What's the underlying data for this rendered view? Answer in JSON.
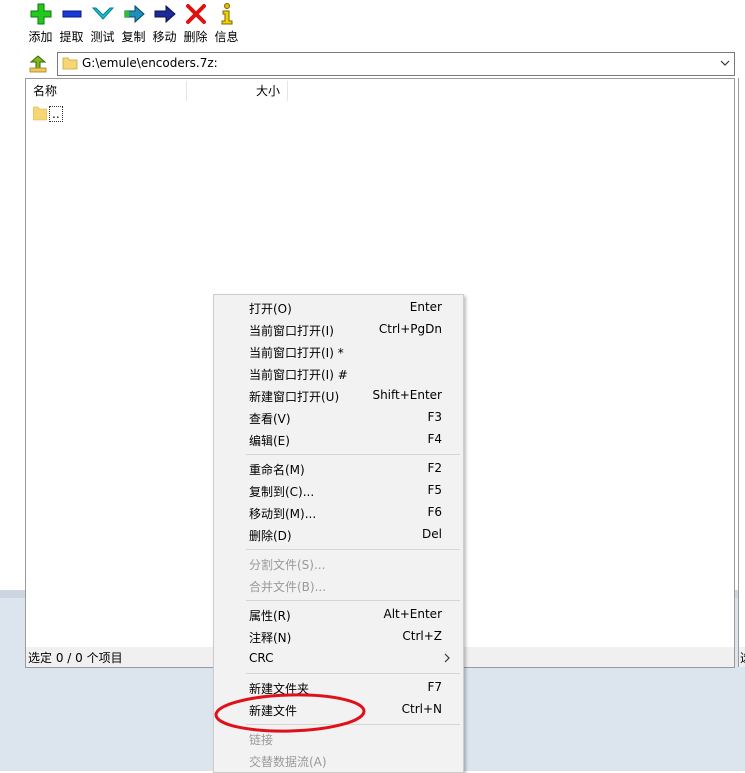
{
  "toolbar": {
    "buttons": [
      {
        "label": "添加",
        "icon": "plus-icon"
      },
      {
        "label": "提取",
        "icon": "minus-icon"
      },
      {
        "label": "测试",
        "icon": "checkmark-icon"
      },
      {
        "label": "复制",
        "icon": "copy-arrow-icon"
      },
      {
        "label": "移动",
        "icon": "move-arrow-icon"
      },
      {
        "label": "删除",
        "icon": "delete-x-icon"
      },
      {
        "label": "信息",
        "icon": "info-icon"
      }
    ]
  },
  "pathbar": {
    "path": "G:\\emule\\encoders.7z:"
  },
  "filelist": {
    "columns": [
      "名称",
      "大小"
    ],
    "rows": [
      {
        "name": ".."
      }
    ]
  },
  "status": {
    "text": "选定 0 / 0 个项目"
  },
  "status_right_text": "选",
  "context_menu": {
    "items": [
      {
        "label": "打开(O)",
        "shortcut": "Enter",
        "disabled": false
      },
      {
        "label": "当前窗口打开(I)",
        "shortcut": "Ctrl+PgDn",
        "disabled": false
      },
      {
        "label": "当前窗口打开(I) *",
        "shortcut": "",
        "disabled": false
      },
      {
        "label": "当前窗口打开(I) #",
        "shortcut": "",
        "disabled": false
      },
      {
        "label": "新建窗口打开(U)",
        "shortcut": "Shift+Enter",
        "disabled": false
      },
      {
        "label": "查看(V)",
        "shortcut": "F3",
        "disabled": false
      },
      {
        "label": "编辑(E)",
        "shortcut": "F4",
        "disabled": false
      },
      {
        "label": "重命名(M)",
        "shortcut": "F2",
        "disabled": false
      },
      {
        "label": "复制到(C)...",
        "shortcut": "F5",
        "disabled": false
      },
      {
        "label": "移动到(M)...",
        "shortcut": "F6",
        "disabled": false
      },
      {
        "label": "删除(D)",
        "shortcut": "Del",
        "disabled": false
      },
      {
        "label": "分割文件(S)...",
        "shortcut": "",
        "disabled": true
      },
      {
        "label": "合并文件(B)...",
        "shortcut": "",
        "disabled": true
      },
      {
        "label": "属性(R)",
        "shortcut": "Alt+Enter",
        "disabled": false
      },
      {
        "label": "注释(N)",
        "shortcut": "Ctrl+Z",
        "disabled": false
      },
      {
        "label": "CRC",
        "shortcut": "",
        "disabled": false,
        "submenu": true
      },
      {
        "label": "新建文件夹",
        "shortcut": "F7",
        "disabled": false
      },
      {
        "label": "新建文件",
        "shortcut": "Ctrl+N",
        "disabled": false,
        "highlighted": true
      },
      {
        "label": "链接",
        "shortcut": "",
        "disabled": true
      },
      {
        "label": "交替数据流(A)",
        "shortcut": "",
        "disabled": true
      }
    ]
  },
  "annotation": {
    "color": "#e0101a"
  }
}
